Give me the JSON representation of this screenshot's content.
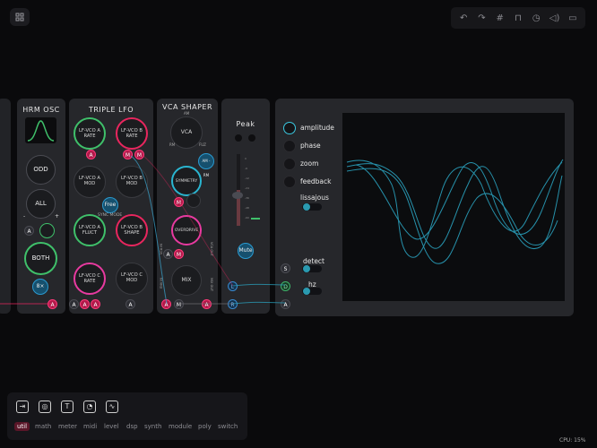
{
  "toolbar": {
    "icons": [
      "undo-icon",
      "redo-icon",
      "grid-icon",
      "lock-icon",
      "clock-icon",
      "volume-icon",
      "panel-icon"
    ]
  },
  "modules": {
    "hrm_osc": {
      "title": "HRM OSC",
      "buttons": {
        "odd": "ODD",
        "all": "ALL",
        "both": "BOTH",
        "mult": "8×"
      },
      "jack_a": "A",
      "minus": "-",
      "plus": "+"
    },
    "triple_lfo": {
      "title": "TRIPLE LFO",
      "knobs": {
        "a_rate": "LF-VCO A\nRATE",
        "b_rate": "LF-VCO B\nRATE",
        "a_mod": "LF-VCO A\nMOD",
        "b_mod": "LF-VCO B\nMOD",
        "a_fluct": "LF-VCO A\nFLUCT",
        "b_shape": "LF-VCO B\nSHAPE",
        "c_rate": "LF-VCO C\nRATE",
        "c_mod": "LF-VCO C\nMOD"
      },
      "free": "Free",
      "sync_mode": "SYNC MODE",
      "jack_a": "A",
      "jack_m": "M"
    },
    "vca_shaper": {
      "title": "VCA SHAPER",
      "subtitle": "AM",
      "vca": "VCA",
      "ring": "RM",
      "fuzz": "FUZ",
      "rm_in": "AM - RM",
      "symmetry": "SYMMETRY",
      "overdrive": "OVERDRIVE",
      "mix": "MIX",
      "jack_a": "A",
      "jack_m": "M",
      "vca_out": "VCA OUT",
      "mix_out": "MIX OUT",
      "side_in": "VCA IN",
      "side_env": "ENV IN"
    },
    "peak": {
      "title": "Peak",
      "mute": "Mute",
      "scale": [
        "0",
        "-6",
        "-12",
        "-24",
        "-36",
        "-48",
        "-60"
      ]
    },
    "scope": {
      "options": [
        "amplitude",
        "phase",
        "zoom",
        "feedback"
      ],
      "lissajous": "lissajous",
      "detect": "detect",
      "hz": "hz",
      "jacks": {
        "s": "S",
        "d": "D",
        "a": "A",
        "l": "L",
        "r": "R"
      }
    }
  },
  "tray": {
    "categories": [
      "util",
      "math",
      "meter",
      "midi",
      "level",
      "dsp",
      "synth",
      "module",
      "poly",
      "switch"
    ],
    "selected": "util",
    "icons": [
      "input-icon",
      "camera-icon",
      "text-icon",
      "clock-icon",
      "scope-icon"
    ]
  },
  "status": {
    "cpu": "CPU: 15%"
  }
}
